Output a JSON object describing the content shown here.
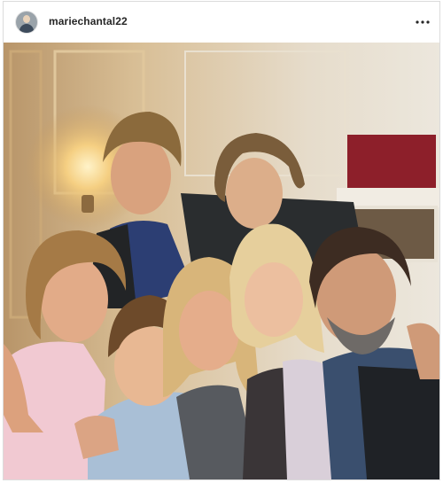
{
  "post": {
    "username": "mariechantal22",
    "avatar_icon": "profile-photo-avatar",
    "more_icon": "more-options-icon",
    "image_description_icon": "family-group-photo"
  },
  "colors": {
    "header_text": "#262626",
    "border": "#dbdbdb",
    "background": "#ffffff"
  }
}
